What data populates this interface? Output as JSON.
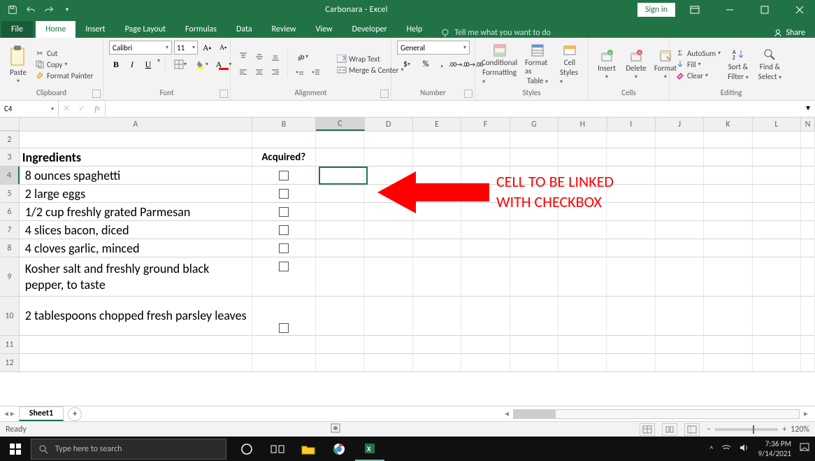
{
  "titlebar": {
    "title": "Carbonara - Excel",
    "signin": "Sign in"
  },
  "tabs": {
    "file": "File",
    "home": "Home",
    "insert": "Insert",
    "pagelayout": "Page Layout",
    "formulas": "Formulas",
    "data": "Data",
    "review": "Review",
    "view": "View",
    "developer": "Developer",
    "help": "Help",
    "tellme": "Tell me what you want to do",
    "share": "Share"
  },
  "ribbon": {
    "clipboard": {
      "paste": "Paste",
      "cut": "Cut",
      "copy": "Copy",
      "fmt": "Format Painter",
      "label": "Clipboard"
    },
    "font": {
      "name": "Calibri",
      "size": "11",
      "label": "Font"
    },
    "alignment": {
      "wrap": "Wrap Text",
      "merge": "Merge & Center",
      "label": "Alignment"
    },
    "number": {
      "fmt": "General",
      "label": "Number"
    },
    "styles": {
      "cond": "Conditional",
      "cond2": "Formatting",
      "table": "Format as",
      "table2": "Table",
      "cell": "Cell",
      "cell2": "Styles",
      "label": "Styles"
    },
    "cells": {
      "insert": "Insert",
      "delete": "Delete",
      "format": "Format",
      "label": "Cells"
    },
    "editing": {
      "autosum": "AutoSum",
      "fill": "Fill",
      "clear": "Clear",
      "sort": "Sort &",
      "sort2": "Filter",
      "find": "Find &",
      "find2": "Select",
      "label": "Editing"
    }
  },
  "fbar": {
    "namebox": "C4"
  },
  "cols": [
    "A",
    "B",
    "C",
    "D",
    "E",
    "F",
    "G",
    "H",
    "I",
    "J",
    "K",
    "L"
  ],
  "annot": {
    "line1": "CELL TO BE LINKED",
    "line2": "WITH CHECKBOX"
  },
  "rows": [
    {
      "n": "2",
      "a": "",
      "b": ""
    },
    {
      "n": "3",
      "a": "Ingredients",
      "b": "Acquired?",
      "hdr": true
    },
    {
      "n": "4",
      "a": "8 ounces spaghetti",
      "cb": true
    },
    {
      "n": "5",
      "a": "2 large eggs",
      "cb": true
    },
    {
      "n": "6",
      "a": "1/2 cup freshly grated Parmesan",
      "cb": true
    },
    {
      "n": "7",
      "a": "4 slices bacon, diced",
      "cb": true
    },
    {
      "n": "8",
      "a": "4 cloves garlic, minced",
      "cb": true
    },
    {
      "n": "9",
      "a": "Kosher salt and freshly ground black pepper, to taste",
      "cb": true,
      "tall": true
    },
    {
      "n": "10",
      "a": "2 tablespoons chopped fresh parsley leaves",
      "cb": true,
      "tall": true,
      "cbbot": true
    },
    {
      "n": "11",
      "a": ""
    },
    {
      "n": "12",
      "a": ""
    }
  ],
  "sheet": {
    "name": "Sheet1"
  },
  "status": {
    "ready": "Ready",
    "rec": "",
    "zoom": "120%"
  },
  "taskbar": {
    "search": "Type here to search",
    "time": "7:36 PM",
    "date": "9/14/2021"
  }
}
